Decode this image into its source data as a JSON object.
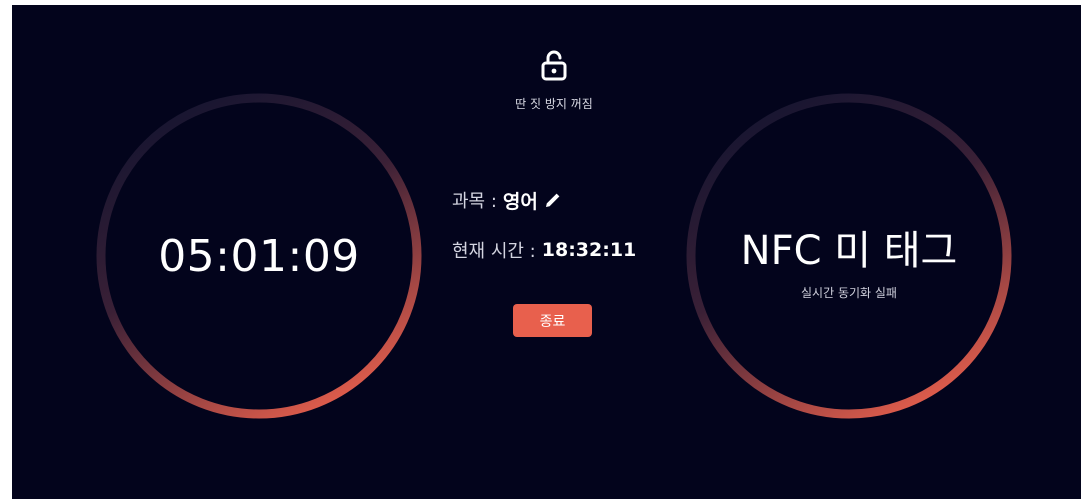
{
  "lock": {
    "icon": "unlock-icon",
    "label": "딴 짓 방지 꺼짐"
  },
  "timer": {
    "elapsed": "05:01:09"
  },
  "info": {
    "subject_label": "과목 :",
    "subject_value": "영어",
    "edit_icon": "pencil-icon",
    "time_label": "현재 시간 :",
    "time_value": "18:32:11"
  },
  "end_button": {
    "label": "종료"
  },
  "nfc": {
    "title": "NFC 미 태그",
    "subtitle": "실시간 동기화 실패"
  },
  "colors": {
    "background": "#03041c",
    "ring_dark": "#1a1a36",
    "ring_accent": "#e8604d",
    "button": "#e8604d"
  }
}
